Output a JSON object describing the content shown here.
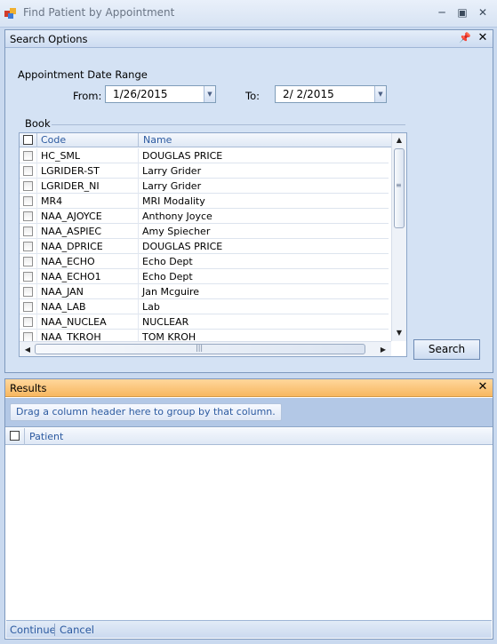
{
  "window": {
    "title": "Find Patient by Appointment",
    "icon": "app-icon",
    "controls": [
      "minimize-icon",
      "maximize-icon",
      "close-icon"
    ]
  },
  "search_panel": {
    "title": "Search Options",
    "pin_icon": "pin-icon",
    "close_icon": "close-icon",
    "date_range": {
      "label": "Appointment Date Range",
      "from_label": "From:",
      "from_value": "1/26/2015",
      "to_label": "To:",
      "to_value": "2/ 2/2015"
    },
    "book": {
      "label": "Book",
      "columns": [
        "Code",
        "Name"
      ],
      "rows": [
        {
          "code": "HC_SML",
          "name": "DOUGLAS PRICE"
        },
        {
          "code": "LGRIDER-ST",
          "name": "Larry Grider"
        },
        {
          "code": "LGRIDER_NI",
          "name": "Larry Grider"
        },
        {
          "code": "MR4",
          "name": "MRI Modality"
        },
        {
          "code": "NAA_AJOYCE",
          "name": "Anthony Joyce"
        },
        {
          "code": "NAA_ASPIEC",
          "name": "Amy Spiecher"
        },
        {
          "code": "NAA_DPRICE",
          "name": "DOUGLAS PRICE"
        },
        {
          "code": "NAA_ECHO",
          "name": "Echo Dept"
        },
        {
          "code": "NAA_ECHO1",
          "name": "Echo Dept"
        },
        {
          "code": "NAA_JAN",
          "name": "Jan Mcguire"
        },
        {
          "code": "NAA_LAB",
          "name": "Lab"
        },
        {
          "code": "NAA_NUCLEA",
          "name": "NUCLEAR"
        },
        {
          "code": "NAA_TKROH",
          "name": "TOM KROH"
        }
      ]
    },
    "search_button": "Search"
  },
  "results_panel": {
    "title": "Results",
    "close_icon": "close-icon",
    "group_hint": "Drag a column header here to group by that column.",
    "columns": [
      "Patient"
    ]
  },
  "footer": {
    "continue_label": "Continue",
    "cancel_label": "Cancel"
  }
}
